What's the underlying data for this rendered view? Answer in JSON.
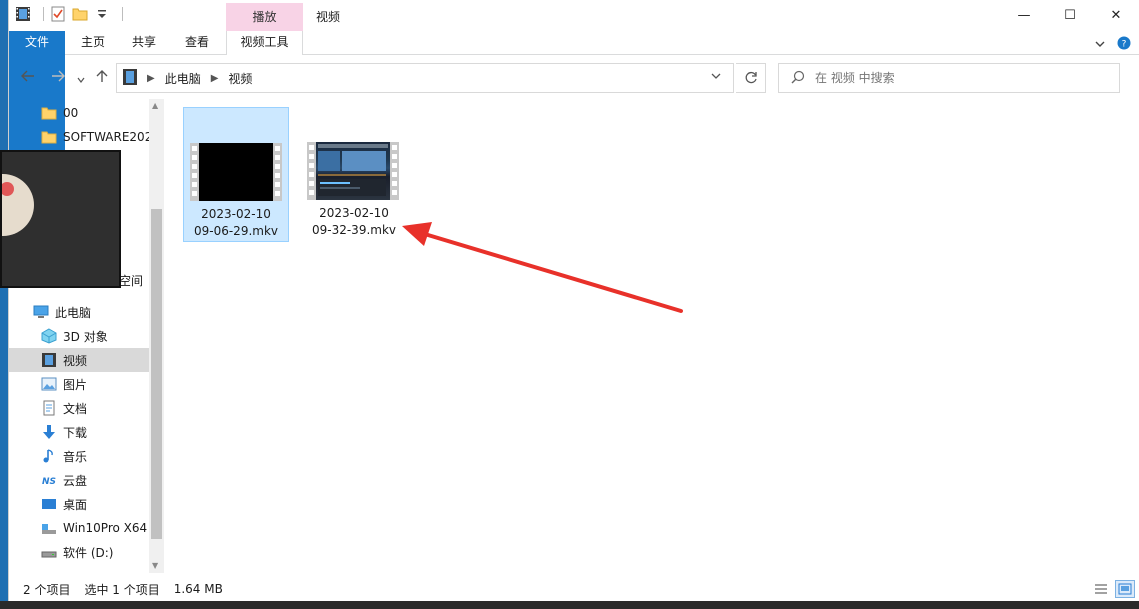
{
  "window": {
    "title": "视频",
    "context_tab_group": "播放",
    "controls": {
      "minimize": "—",
      "maximize": "☐",
      "close": "✕"
    }
  },
  "ribbon": {
    "tabs": [
      {
        "label": "文件"
      },
      {
        "label": "主页"
      },
      {
        "label": "共享"
      },
      {
        "label": "查看"
      },
      {
        "label": "视频工具"
      }
    ],
    "file_tab_color": "#1979ca",
    "context_color": "#f8d3e6"
  },
  "address": {
    "crumbs": [
      "此电脑",
      "视频"
    ],
    "search_placeholder": "在 视频 中搜索"
  },
  "nav": {
    "items": [
      {
        "label": "00",
        "icon": "folder-icon"
      },
      {
        "label": "SOFTWARE202",
        "icon": "folder-icon"
      },
      {
        "label": "空间",
        "icon": "cloud-icon"
      },
      {
        "label": "此电脑",
        "icon": "computer-icon"
      },
      {
        "label": "3D 对象",
        "icon": "cube-icon"
      },
      {
        "label": "视频",
        "icon": "video-icon",
        "selected": true
      },
      {
        "label": "图片",
        "icon": "picture-icon"
      },
      {
        "label": "文档",
        "icon": "document-icon"
      },
      {
        "label": "下载",
        "icon": "download-icon"
      },
      {
        "label": "音乐",
        "icon": "music-icon"
      },
      {
        "label": "云盘",
        "icon": "cloud-drive-icon"
      },
      {
        "label": "桌面",
        "icon": "desktop-icon"
      },
      {
        "label": "Win10Pro X64",
        "icon": "drive-icon"
      },
      {
        "label": "软件 (D:)",
        "icon": "drive-icon"
      }
    ]
  },
  "files": [
    {
      "line1": "2023-02-10",
      "line2": "09-06-29.mkv",
      "selected": true,
      "thumb": "black"
    },
    {
      "line1": "2023-02-10",
      "line2": "09-32-39.mkv",
      "selected": false,
      "thumb": "app"
    }
  ],
  "status": {
    "count": "2 个项目",
    "selection": "选中 1 个项目",
    "size": "1.64 MB"
  },
  "annotation_color": "#e8312a"
}
